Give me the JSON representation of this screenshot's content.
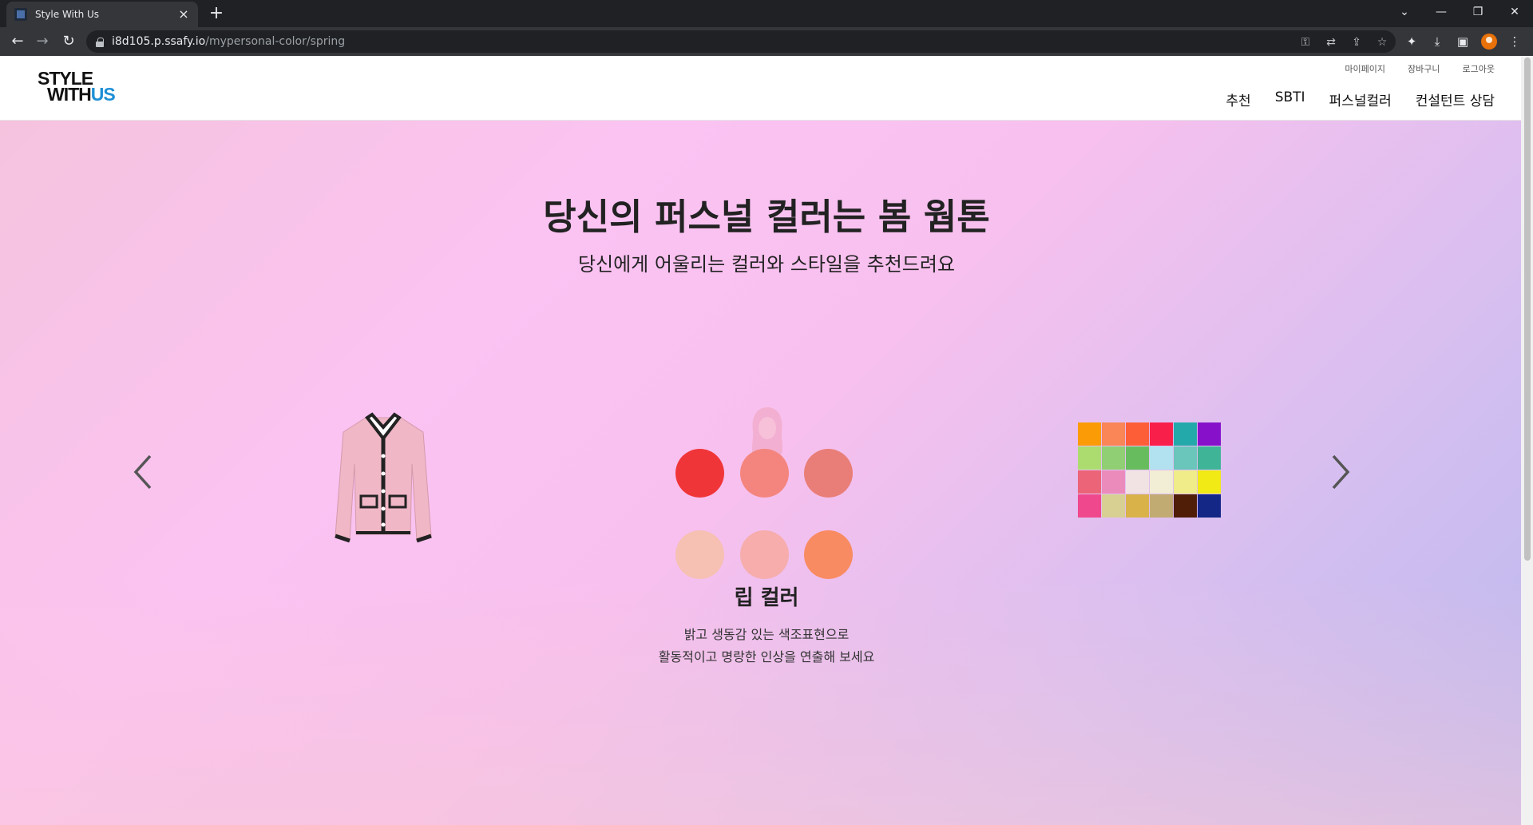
{
  "browser": {
    "tab_title": "Style With Us",
    "tab_close": "×",
    "new_tab": "+",
    "url_host": "i8d105.p.ssafy.io",
    "url_path": "/mypersonal-color/spring"
  },
  "header": {
    "logo_line1": "STYLE",
    "logo_line2_a": "WITH",
    "logo_line2_b": "US",
    "logo_accent_color": "#1d8fd6",
    "util_links": [
      "마이페이지",
      "장바구니",
      "로그아웃"
    ],
    "nav": [
      "추천",
      "SBTI",
      "퍼스널컬러",
      "컨설턴트 상담"
    ]
  },
  "hero": {
    "title": "당신의 퍼스널 컬러는 봄 웜톤",
    "subtitle": "당신에게 어울리는 컬러와 스타일을 추천드려요",
    "card_title": "립 컬러",
    "card_desc_line1": "밝고 생동감 있는 색조표현으로",
    "card_desc_line2": "활동적이고 명랑한 인상을 연출해 보세요",
    "lip_colors": [
      "#f03538",
      "#f4857e",
      "#e97e78",
      "#f6c0b3",
      "#f6adac",
      "#f98b62"
    ],
    "palette_colors": [
      "#fb9b06",
      "#fa8556",
      "#fd5e38",
      "#f91f4b",
      "#23a9aa",
      "#8711ca",
      "#acdc70",
      "#90cf73",
      "#67bd5d",
      "#b2e2ef",
      "#6ac5bb",
      "#40b497",
      "#ec6478",
      "#eb8bbc",
      "#f1e2e4",
      "#f2edd5",
      "#f0ec8a",
      "#f1ea14",
      "#f0488c",
      "#d8d093",
      "#d9b34a",
      "#c2ab73",
      "#501d06",
      "#142686"
    ]
  }
}
